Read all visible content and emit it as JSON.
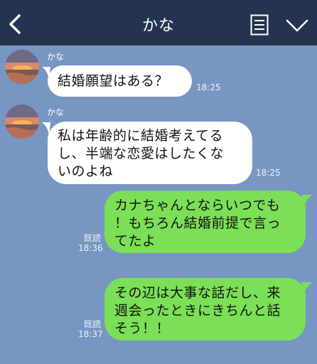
{
  "header": {
    "title": "かな"
  },
  "colors": {
    "header_bg": "#243450",
    "chat_bg": "#7896c2",
    "incoming_bubble": "#ffffff",
    "outgoing_bubble": "#7bdf57"
  },
  "messages": [
    {
      "sender": "かな",
      "lines": [
        "結婚願望はある？"
      ],
      "time": "18:25"
    },
    {
      "sender": "かな",
      "lines": [
        "私は年齢的に結婚考えてる",
        "し、半端な恋愛はしたくな",
        "いのよね"
      ],
      "time": "18:25"
    },
    {
      "read": "既読",
      "lines": [
        "カナちゃんとならいつでも",
        "！もちろん結婚前提で言っ",
        "てたよ"
      ],
      "time": "18:36"
    },
    {
      "read": "既読",
      "lines": [
        "その辺は大事な話だし、来",
        "週会ったときにきちんと話",
        "そう！！"
      ],
      "time": "18:37"
    }
  ]
}
